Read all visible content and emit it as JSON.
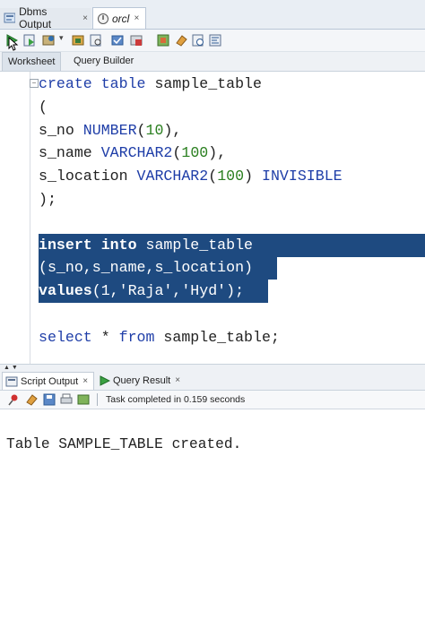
{
  "doc_tabs": [
    {
      "label": "Dbms Output",
      "close": "×"
    },
    {
      "label": "orcl",
      "close": "×"
    }
  ],
  "sub_tabs": {
    "worksheet": "Worksheet",
    "query_builder": "Query Builder"
  },
  "editor": {
    "fold_marker": "−",
    "lines": [
      "create table sample_table",
      "(",
      "s_no NUMBER(10),",
      "s_name VARCHAR2(100),",
      "s_location VARCHAR2(100) INVISIBLE",
      ");",
      "insert into sample_table",
      "(s_no,s_name,s_location)",
      "values(1,'Raja','Hyd');",
      "select * from sample_table;"
    ]
  },
  "output_tabs": [
    {
      "label": "Script Output",
      "close": "×"
    },
    {
      "label": "Query Result",
      "close": "×"
    }
  ],
  "status": "Task completed in 0.159 seconds",
  "output": {
    "text": "Table SAMPLE_TABLE created."
  },
  "colors": {
    "keyword": "#1f3ea8",
    "number": "#2a7f1f",
    "selection": "#1e4a80"
  }
}
